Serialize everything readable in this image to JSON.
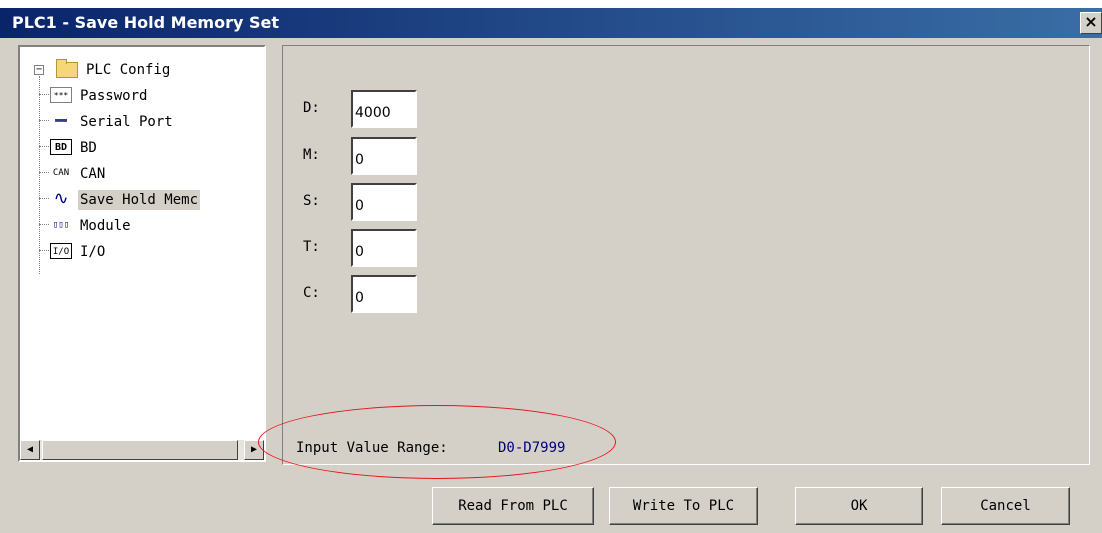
{
  "window": {
    "title": "PLC1 - Save Hold Memory Set",
    "close_symbol": "×"
  },
  "tree": {
    "expander_symbol": "−",
    "root": {
      "label": "PLC Config",
      "icon": "folder-icon"
    },
    "items": [
      {
        "label": "Password",
        "icon": "password-icon",
        "icon_text": "***"
      },
      {
        "label": "Serial Port",
        "icon": "serial-port-icon",
        "icon_text": "▬▬"
      },
      {
        "label": "BD",
        "icon": "bd-icon",
        "icon_text": "BD"
      },
      {
        "label": "CAN",
        "icon": "can-icon",
        "icon_text": "CAN"
      },
      {
        "label": "Save Hold Memc",
        "icon": "waveform-icon",
        "icon_text": "∿",
        "selected": true
      },
      {
        "label": "Module",
        "icon": "module-icon",
        "icon_text": "▯▯▯"
      },
      {
        "label": "I/O",
        "icon": "io-icon",
        "icon_text": "I/O"
      }
    ],
    "scroll_left": "◀",
    "scroll_right": "▶"
  },
  "fields": [
    {
      "label": "D:",
      "value": "4000"
    },
    {
      "label": "M:",
      "value": "0"
    },
    {
      "label": "S:",
      "value": "0"
    },
    {
      "label": "T:",
      "value": "0"
    },
    {
      "label": "C:",
      "value": "0"
    }
  ],
  "range": {
    "label": "Input Value Range:",
    "value": "D0-D7999"
  },
  "buttons": {
    "read": "Read From PLC",
    "write": "Write To PLC",
    "ok": "OK",
    "cancel": "Cancel"
  },
  "colors": {
    "titlebar_start": "#0a246a",
    "titlebar_end": "#3a6ea5",
    "dialog_bg": "#d4d0c8",
    "highlight_ellipse": "#e8141b",
    "range_value": "#000080"
  }
}
